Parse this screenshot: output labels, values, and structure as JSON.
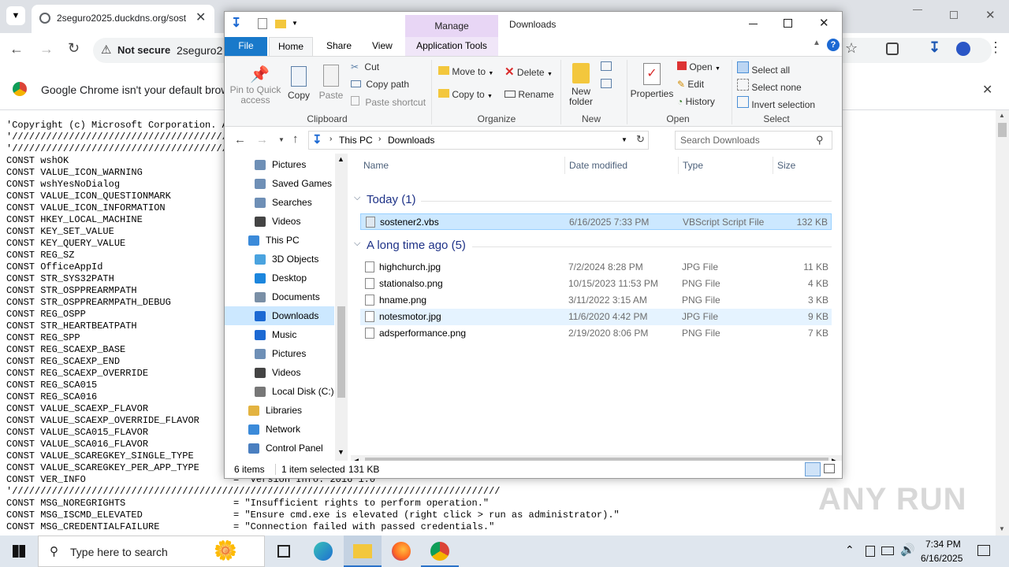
{
  "chrome": {
    "tab_title": "2seguro2025.duckdns.org/sost",
    "not_secure": "Not secure",
    "url": "2seguro2",
    "infobar_text": "Google Chrome isn't your default browse"
  },
  "script_lines": [
    "'Copyright (c) Microsoft Corporation. A",
    "'//////////////////////////////////////",
    "'//////////////////////////////////////",
    "CONST wshOK",
    "CONST VALUE_ICON_WARNING",
    "CONST wshYesNoDialog",
    "CONST VALUE_ICON_QUESTIONMARK",
    "CONST VALUE_ICON_INFORMATION",
    "CONST HKEY_LOCAL_MACHINE",
    "CONST KEY_SET_VALUE",
    "CONST KEY_QUERY_VALUE",
    "CONST REG_SZ",
    "CONST OfficeAppId",
    "CONST STR_SYS32PATH",
    "CONST STR_OSPPREARMPATH",
    "CONST STR_OSPPREARMPATH_DEBUG",
    "CONST REG_OSPP",
    "CONST STR_HEARTBEATPATH",
    "CONST REG_SPP",
    "CONST REG_SCAEXP_BASE",
    "CONST REG_SCAEXP_END",
    "CONST REG_SCAEXP_OVERRIDE",
    "CONST REG_SCA015",
    "CONST REG_SCA016",
    "CONST VALUE_SCAEXP_FLAVOR",
    "CONST VALUE_SCAEXP_OVERRIDE_FLAVOR",
    "CONST VALUE_SCA015_FLAVOR",
    "CONST VALUE_SCA016_FLAVOR",
    "CONST VALUE_SCAREGKEY_SINGLE_TYPE",
    "CONST VALUE_SCAREGKEY_PER_APP_TYPE",
    "CONST VER_INFO                          = \"Version Info: 2016 1.0\"",
    "'//////////////////////////////////////////////////////////////////////////////////////",
    "CONST MSG_NOREGRIGHTS                   = \"Insufficient rights to perform operation.\"",
    "CONST MSG_ISCMD_ELEVATED                = \"Ensure cmd.exe is elevated (right click > run as administrator).\"",
    "CONST MSG_CREDENTIALFAILURE             = \"Connection failed with passed credentials.\""
  ],
  "explorer": {
    "manage": "Manage",
    "title": "Downloads",
    "tabs": [
      "File",
      "Home",
      "Share",
      "View",
      "Application Tools"
    ],
    "clipboard": {
      "pin": "Pin to Quick access",
      "copy": "Copy",
      "paste": "Paste",
      "cut": "Cut",
      "copy_path": "Copy path",
      "paste_shortcut": "Paste shortcut",
      "group": "Clipboard"
    },
    "organize": {
      "move_to": "Move to",
      "copy_to": "Copy to",
      "delete": "Delete",
      "rename": "Rename",
      "group": "Organize"
    },
    "new": {
      "new_folder": "New folder",
      "group": "New"
    },
    "open": {
      "properties": "Properties",
      "open": "Open",
      "edit": "Edit",
      "history": "History",
      "group": "Open"
    },
    "select": {
      "select_all": "Select all",
      "select_none": "Select none",
      "invert": "Invert selection",
      "group": "Select"
    },
    "breadcrumb": [
      "This PC",
      "Downloads"
    ],
    "search_placeholder": "Search Downloads",
    "nav": [
      "Pictures",
      "Saved Games",
      "Searches",
      "Videos",
      "This PC",
      "3D Objects",
      "Desktop",
      "Documents",
      "Downloads",
      "Music",
      "Pictures",
      "Videos",
      "Local Disk (C:)",
      "Libraries",
      "Network",
      "Control Panel"
    ],
    "columns": {
      "name": "Name",
      "date": "Date modified",
      "type": "Type",
      "size": "Size"
    },
    "groups": [
      {
        "label": "Today (1)",
        "files": [
          {
            "name": "sostener2.vbs",
            "date": "6/16/2025 7:33 PM",
            "type": "VBScript Script File",
            "size": "132 KB"
          }
        ]
      },
      {
        "label": "A long time ago (5)",
        "files": [
          {
            "name": "highchurch.jpg",
            "date": "7/2/2024 8:28 PM",
            "type": "JPG File",
            "size": "11 KB"
          },
          {
            "name": "stationalso.png",
            "date": "10/15/2023 11:53 PM",
            "type": "PNG File",
            "size": "4 KB"
          },
          {
            "name": "hname.png",
            "date": "3/11/2022 3:15 AM",
            "type": "PNG File",
            "size": "3 KB"
          },
          {
            "name": "notesmotor.jpg",
            "date": "11/6/2020 4:42 PM",
            "type": "JPG File",
            "size": "9 KB"
          },
          {
            "name": "adsperformance.png",
            "date": "2/19/2020 8:06 PM",
            "type": "PNG File",
            "size": "7 KB"
          }
        ]
      }
    ],
    "status": {
      "items": "6 items",
      "selected": "1 item selected",
      "size": "131 KB"
    }
  },
  "taskbar": {
    "search": "Type here to search",
    "time": "7:34 PM",
    "date": "6/16/2025"
  },
  "watermark": "ANY RUN"
}
